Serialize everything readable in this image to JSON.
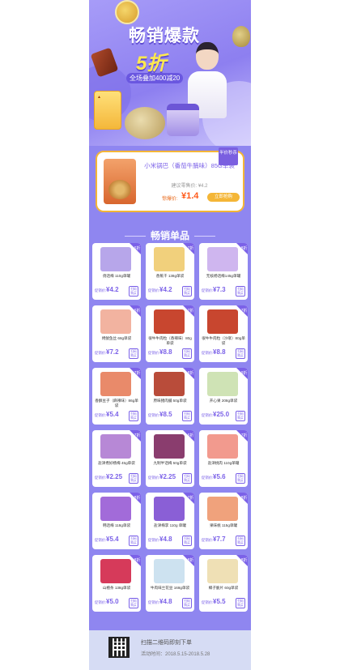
{
  "hero": {
    "title": "畅销爆款",
    "discount": "5折",
    "subtitle": "全场叠加400减20"
  },
  "flash_sale": {
    "badge": "半价秒杀",
    "name": "小米锅巴（番茄牛腩味）85G单袋",
    "ref_price": "建议零售价: ¥4.2",
    "price_label": "惊爆价:",
    "price": "¥1.4",
    "button": "立即抢购"
  },
  "section_title": "畅销单品",
  "labels": {
    "price_label": "促销价:",
    "buy": "扫码购买"
  },
  "products": [
    {
      "name": "俏话梅 110g单罐",
      "price": "¥4.2",
      "discount": "6折"
    },
    {
      "name": "香蕉干 138g单袋",
      "price": "¥4.2",
      "discount": "7折"
    },
    {
      "name": "无核杨话梅145g单罐",
      "price": "¥7.3",
      "discount": "8折"
    },
    {
      "name": "烤鱿鱼丝 68g单袋",
      "price": "¥7.2",
      "discount": "6折"
    },
    {
      "name": "很牛牛肉粒（香辣味）80g单袋",
      "price": "¥8.8",
      "discount": "7折"
    },
    {
      "name": "很牛牛肉粒（沙嗲）80g单袋",
      "price": "¥8.8",
      "discount": "7折"
    },
    {
      "name": "香酥豆子（麻辣味）86g单袋",
      "price": "¥5.4",
      "discount": "7折"
    },
    {
      "name": "原味猪肉脯 50g单袋",
      "price": "¥8.5",
      "discount": "8折"
    },
    {
      "name": "开心果 208g单袋",
      "price": "¥25.0",
      "discount": "9折"
    },
    {
      "name": "盐津煮好杨梅 45g单袋",
      "price": "¥2.25",
      "discount": "7折"
    },
    {
      "name": "九制半话梅 50g单袋",
      "price": "¥2.25",
      "discount": "6折"
    },
    {
      "name": "盐津桃肉 110g单罐",
      "price": "¥5.6",
      "discount": "7折"
    },
    {
      "name": "韩话梅 118g单袋",
      "price": "¥5.4",
      "discount": "8折"
    },
    {
      "name": "盐津梅李 110g 单罐",
      "price": "¥4.8",
      "discount": "7折"
    },
    {
      "name": "果味桃 115g单罐",
      "price": "¥7.7",
      "discount": "8折"
    },
    {
      "name": "山楂条 138g单袋",
      "price": "¥5.0",
      "discount": "8折"
    },
    {
      "name": "牛肉味兰花豆 168g单袋",
      "price": "¥4.8",
      "discount": "8折"
    },
    {
      "name": "椰子脆片 60g单袋",
      "price": "¥5.5",
      "discount": "8折"
    }
  ],
  "thumb_colors": [
    "#b7a6ea",
    "#f1d07c",
    "#cfb6ef",
    "#f2b3a0",
    "#c8462f",
    "#c8462f",
    "#e98a6a",
    "#b94c3a",
    "#cfe3b5",
    "#b788d6",
    "#8a3d6e",
    "#f29a8e",
    "#a26bd9",
    "#8a5fd6",
    "#f0a27c",
    "#d63a5a",
    "#cde2f0",
    "#efe0b5"
  ],
  "footer": {
    "text": "扫描二维码即刻下单",
    "date": "活动时间：2018.5.15-2018.5.28"
  }
}
